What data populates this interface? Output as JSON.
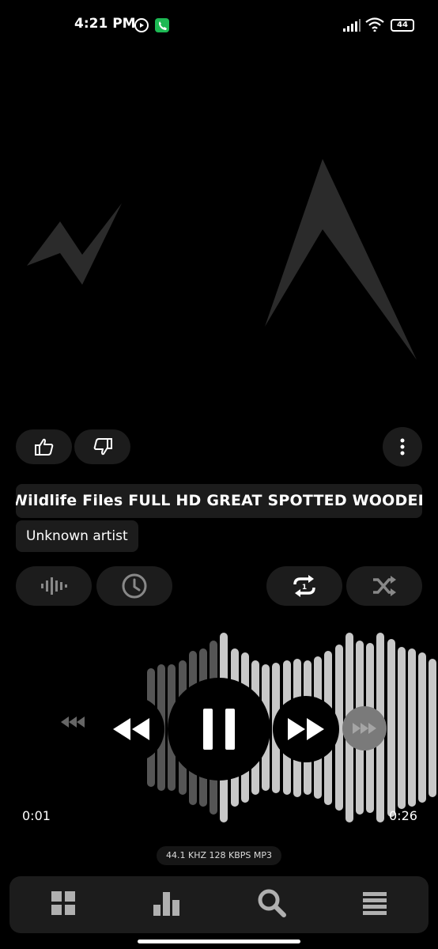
{
  "status_bar": {
    "time": "4:21 PM",
    "battery": "44"
  },
  "track": {
    "title": "Wildlife Files FULL HD GREAT SPOTTED WOODEPECKER",
    "artist": "Unknown artist"
  },
  "player": {
    "elapsed": "0:01",
    "duration": "0:26",
    "quality": "44.1 KHZ  128 KBPS  MP3",
    "is_playing": true
  },
  "icons": {
    "like": "thumbs-up-icon",
    "dislike": "thumbs-down-icon",
    "more": "more-vertical-icon",
    "equalizer": "equalizer-icon",
    "sleep_timer": "clock-icon",
    "repeat": "repeat-one-icon",
    "shuffle": "shuffle-icon",
    "nav": [
      "grid-icon",
      "bar-chart-icon",
      "search-icon",
      "menu-icon"
    ]
  },
  "colors": {
    "background": "#000000",
    "surface": "#1c1c1c",
    "wave_played": "#555555",
    "wave_unplayed": "#c8c8c8"
  }
}
